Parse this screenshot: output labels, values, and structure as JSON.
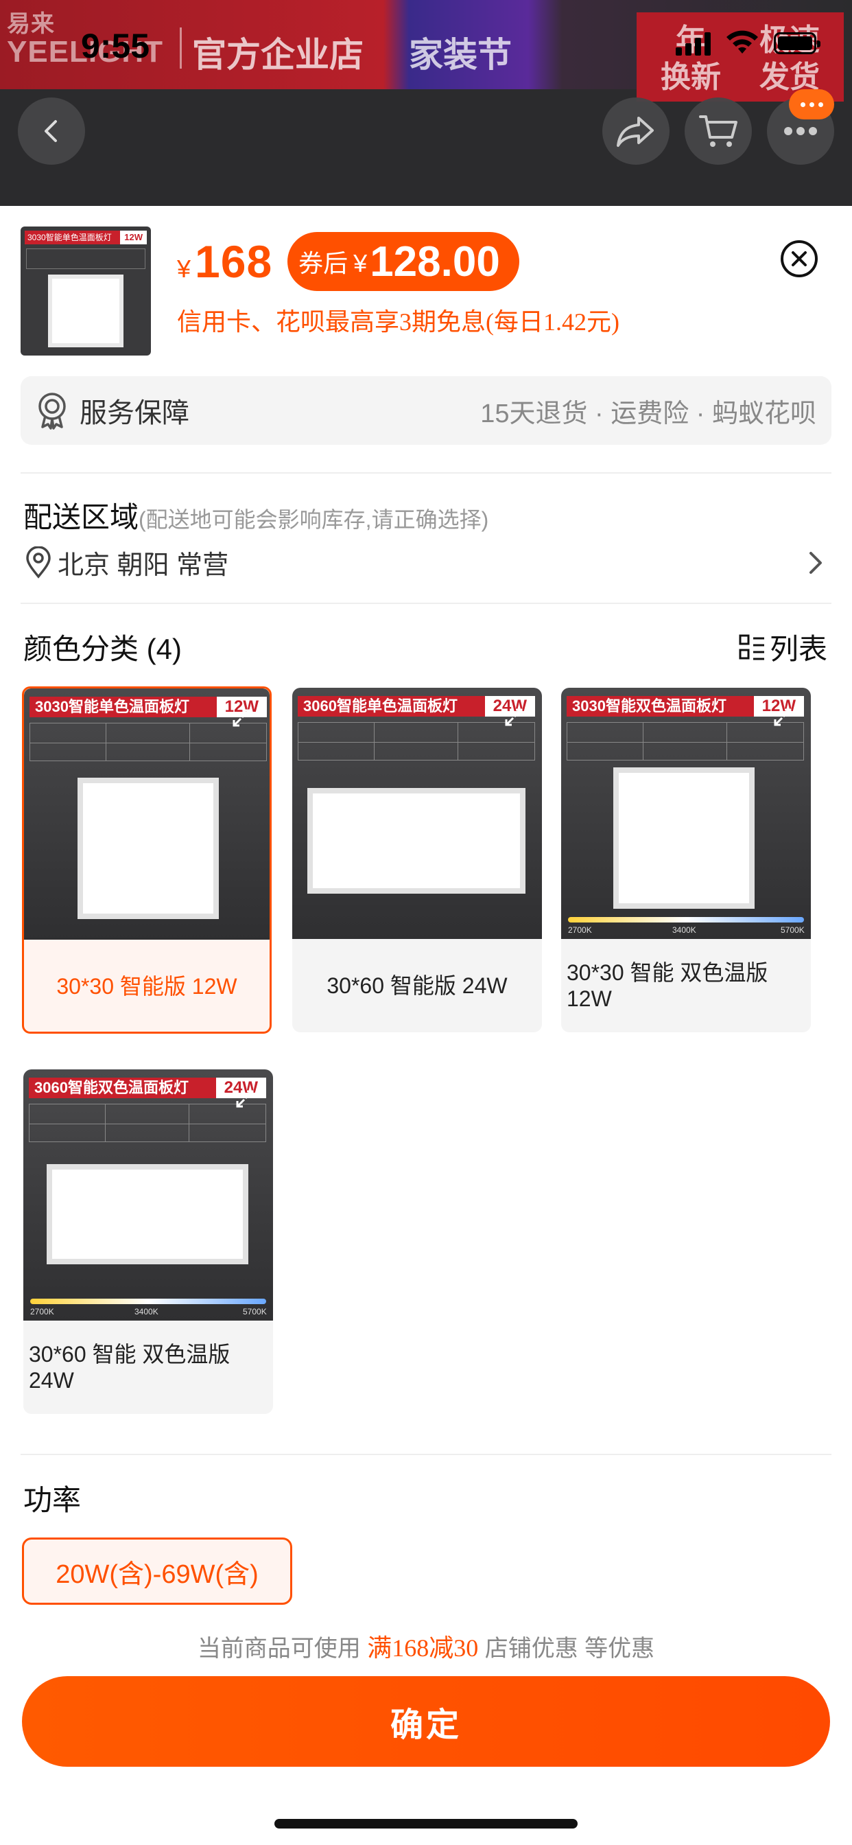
{
  "status_bar": {
    "time": "9:55"
  },
  "banner": {
    "brand_cn": "易来",
    "brand_en": "YEELIGHT",
    "shop_label": "官方企业店",
    "festival_label": "家装节",
    "badge_left": [
      "年",
      "换新"
    ],
    "badge_right": [
      "极速",
      "发货"
    ]
  },
  "nav": {
    "back_icon": "chevron-left-icon",
    "share_icon": "share-icon",
    "cart_icon": "cart-icon",
    "more_icon": "more-icon"
  },
  "product": {
    "thumb_tag_title": "3030智能单色温面板灯",
    "thumb_tag_power": "12W",
    "currency": "¥",
    "price": "168",
    "coupon_label": "券后",
    "coupon_currency": "¥",
    "coupon_price": "128.00",
    "installment": "信用卡、花呗最高享3期免息(每日1.42元)"
  },
  "service": {
    "label": "服务保障",
    "value": "15天退货 · 运费险 · 蚂蚁花呗"
  },
  "delivery": {
    "title": "配送区域",
    "note": "(配送地可能会影响库存,请正确选择)",
    "address": "北京 朝阳 常营"
  },
  "color_category": {
    "title": "颜色分类 (4)",
    "list_toggle_label": "列表",
    "options": [
      {
        "tag_title": "3030智能单色温面板灯",
        "tag_power": "12W",
        "label": "30*30 智能版 12W",
        "selected": true
      },
      {
        "tag_title": "3060智能单色温面板灯",
        "tag_power": "24W",
        "label": "30*60 智能版 24W",
        "selected": false
      },
      {
        "tag_title": "3030智能双色温面板灯",
        "tag_power": "12W",
        "label": "30*30 智能 双色温版 12W",
        "selected": false,
        "gradient_labels": [
          "2700K",
          "3400K",
          "5700K"
        ]
      },
      {
        "tag_title": "3060智能双色温面板灯",
        "tag_power": "24W",
        "label": "30*60 智能  双色温版 24W",
        "selected": false,
        "gradient_labels": [
          "2700K",
          "3400K",
          "5700K"
        ]
      }
    ]
  },
  "power": {
    "title": "功率",
    "option": "20W(含)-69W(含)"
  },
  "promo": {
    "prefix": "当前商品可使用",
    "highlight": "满168减30",
    "suffix": "店铺优惠 等优惠"
  },
  "confirm_label": "确定",
  "colors": {
    "accent": "#ff5000",
    "brand_red": "#c8202b"
  }
}
